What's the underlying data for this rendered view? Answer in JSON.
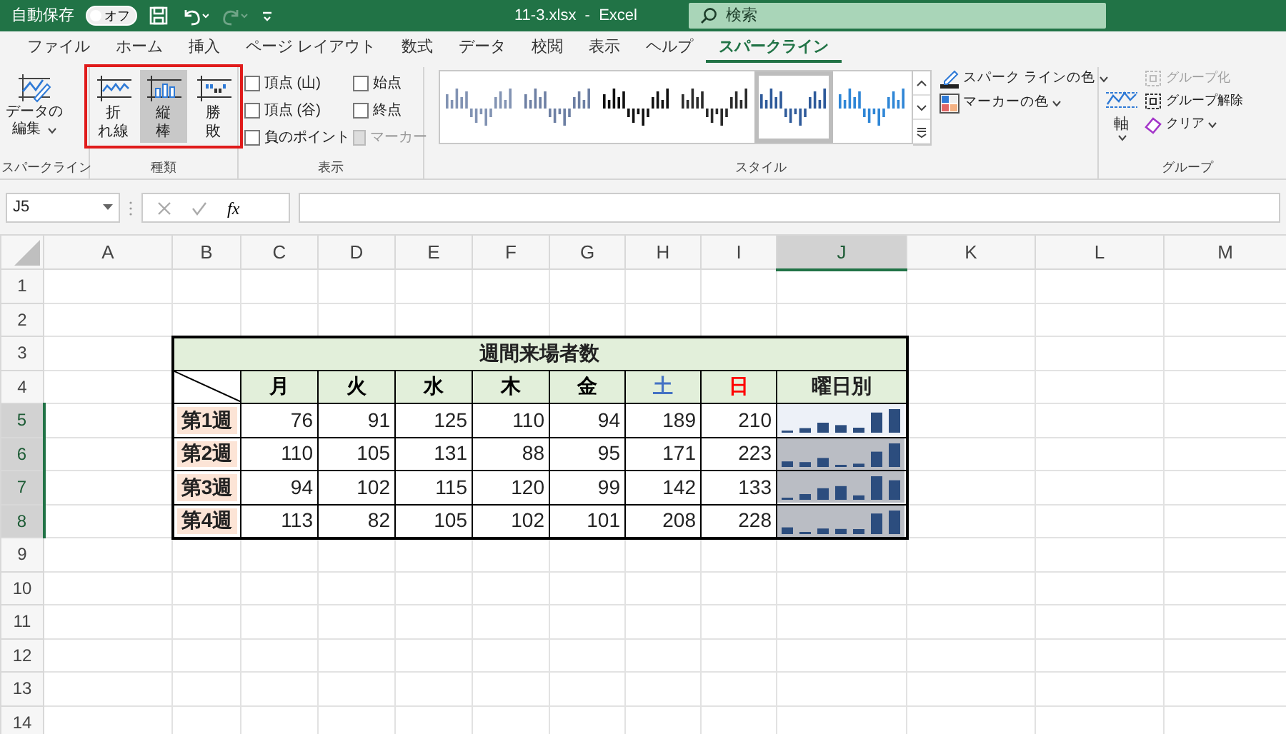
{
  "title_bar": {
    "autosave_label": "自動保存",
    "autosave_toggle": {
      "label": "オフ",
      "on": false
    },
    "redo_disabled": true,
    "title": "11-3.xlsx  -  Excel",
    "search": {
      "placeholder": "検索"
    }
  },
  "tabs": [
    {
      "label": "ファイル",
      "selected": false
    },
    {
      "label": "ホーム",
      "selected": false
    },
    {
      "label": "挿入",
      "selected": false
    },
    {
      "label": "ページ レイアウト",
      "selected": false
    },
    {
      "label": "数式",
      "selected": false
    },
    {
      "label": "データ",
      "selected": false
    },
    {
      "label": "校閲",
      "selected": false
    },
    {
      "label": "表示",
      "selected": false
    },
    {
      "label": "ヘルプ",
      "selected": false
    },
    {
      "label": "スパークライン",
      "selected": true
    }
  ],
  "ribbon": {
    "sparkline_group": {
      "label": "スパークライン",
      "edit_button": [
        "データの",
        "編集"
      ]
    },
    "type_group": {
      "label": "種類",
      "highlighted": true,
      "buttons": [
        {
          "lines": [
            "折",
            "れ線"
          ],
          "kind": "line",
          "selected": false
        },
        {
          "lines": [
            "縦",
            "棒"
          ],
          "kind": "column",
          "selected": true
        },
        {
          "lines": [
            "勝",
            "敗"
          ],
          "kind": "winloss",
          "selected": false
        }
      ]
    },
    "show_group": {
      "label": "表示",
      "options": [
        {
          "label": "頂点 (山)",
          "checked": false,
          "disabled": false
        },
        {
          "label": "頂点 (谷)",
          "checked": false,
          "disabled": false
        },
        {
          "label": "負のポイント",
          "checked": false,
          "disabled": false
        },
        {
          "label": "始点",
          "checked": false,
          "disabled": false
        },
        {
          "label": "終点",
          "checked": false,
          "disabled": false
        },
        {
          "label": "マーカー",
          "checked": false,
          "disabled": true
        }
      ]
    },
    "style_group": {
      "label": "スタイル",
      "styles": [
        {
          "color": "#8293b3",
          "selected": false
        },
        {
          "color": "#6d7fa3",
          "selected": false
        },
        {
          "color": "#111111",
          "selected": false
        },
        {
          "color": "#2b2b2b",
          "selected": false
        },
        {
          "color": "#2e5a9a",
          "selected": true
        },
        {
          "color": "#2f86d6",
          "selected": false
        }
      ]
    },
    "color_buttons": [
      {
        "label": "スパーク ラインの色",
        "kind": "sparkline_color"
      },
      {
        "label": "マーカーの色",
        "kind": "marker_color"
      }
    ],
    "group_group": {
      "label": "グループ",
      "axis_label": "軸",
      "buttons": [
        {
          "label": "グループ化",
          "kind": "group",
          "disabled": true
        },
        {
          "label": "グループ解除",
          "kind": "ungroup",
          "disabled": false
        },
        {
          "label": "クリア",
          "kind": "clear",
          "disabled": false
        }
      ]
    }
  },
  "formula_bar": {
    "name_box": "J5",
    "fx": "fx"
  },
  "sheet": {
    "columns": [
      {
        "label": "A",
        "selected": false
      },
      {
        "label": "B",
        "selected": false
      },
      {
        "label": "C",
        "selected": false
      },
      {
        "label": "D",
        "selected": false
      },
      {
        "label": "E",
        "selected": false
      },
      {
        "label": "F",
        "selected": false
      },
      {
        "label": "G",
        "selected": false
      },
      {
        "label": "H",
        "selected": false
      },
      {
        "label": "I",
        "selected": false
      },
      {
        "label": "J",
        "selected": true
      },
      {
        "label": "K",
        "selected": false
      },
      {
        "label": "L",
        "selected": false
      },
      {
        "label": "M",
        "selected": false
      }
    ],
    "rows": [
      {
        "label": "1",
        "selected": false
      },
      {
        "label": "2",
        "selected": false
      },
      {
        "label": "3",
        "selected": false
      },
      {
        "label": "4",
        "selected": false
      },
      {
        "label": "5",
        "selected": true
      },
      {
        "label": "6",
        "selected": true
      },
      {
        "label": "7",
        "selected": true
      },
      {
        "label": "8",
        "selected": true
      },
      {
        "label": "9",
        "selected": false
      },
      {
        "label": "10",
        "selected": false
      },
      {
        "label": "11",
        "selected": false
      },
      {
        "label": "12",
        "selected": false
      },
      {
        "label": "13",
        "selected": false
      },
      {
        "label": "14",
        "selected": false
      }
    ],
    "table": {
      "title": "週間来場者数",
      "summary_header": "曜日別",
      "days": [
        {
          "label": "月",
          "color": "#000000"
        },
        {
          "label": "火",
          "color": "#000000"
        },
        {
          "label": "水",
          "color": "#000000"
        },
        {
          "label": "木",
          "color": "#000000"
        },
        {
          "label": "金",
          "color": "#000000"
        },
        {
          "label": "土",
          "color": "#4472c4"
        },
        {
          "label": "日",
          "color": "#ff0000"
        }
      ],
      "weeks": [
        {
          "label": "第1週",
          "values": [
            "76",
            "91",
            "125",
            "110",
            "94",
            "189",
            "210"
          ],
          "sparkline_active": true
        },
        {
          "label": "第2週",
          "values": [
            "110",
            "105",
            "131",
            "88",
            "95",
            "171",
            "223"
          ],
          "sparkline_active": false
        },
        {
          "label": "第3週",
          "values": [
            "94",
            "102",
            "115",
            "120",
            "99",
            "142",
            "133"
          ],
          "sparkline_active": false
        },
        {
          "label": "第4週",
          "values": [
            "113",
            "82",
            "105",
            "102",
            "101",
            "208",
            "228"
          ],
          "sparkline_active": false
        }
      ]
    }
  }
}
